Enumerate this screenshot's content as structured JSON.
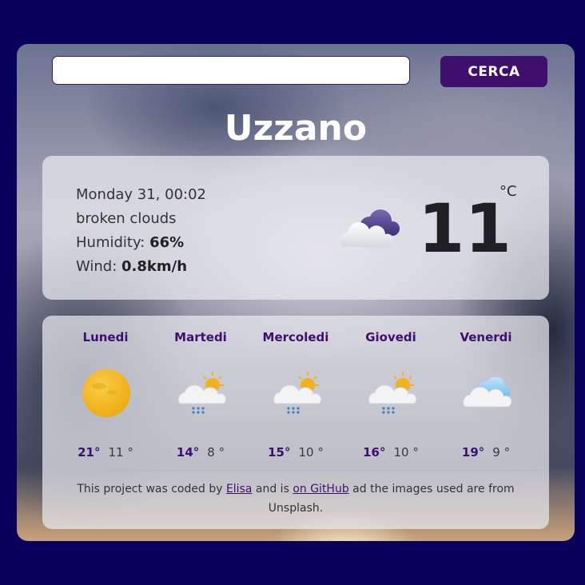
{
  "search": {
    "value": "",
    "placeholder": "",
    "button_label": "CERCA"
  },
  "city": "Uzzano",
  "current": {
    "datetime": "Monday 31, 00:02",
    "description": "broken clouds",
    "humidity_label": "Humidity: ",
    "humidity_value": "66%",
    "wind_label": "Wind: ",
    "wind_value": "0.8km/h",
    "temperature": "11",
    "unit": "°C",
    "icon": "broken-clouds-icon"
  },
  "forecast": [
    {
      "day": "Lunedi",
      "max": "21°",
      "min": "11 °",
      "icon": "sun-icon"
    },
    {
      "day": "Martedi",
      "max": "14°",
      "min": "8 °",
      "icon": "sun-rain-icon"
    },
    {
      "day": "Mercoledi",
      "max": "15°",
      "min": "10 °",
      "icon": "sun-rain-icon"
    },
    {
      "day": "Giovedi",
      "max": "16°",
      "min": "10 °",
      "icon": "sun-rain-icon"
    },
    {
      "day": "Venerdi",
      "max": "19°",
      "min": "9 °",
      "icon": "cloud-icon"
    }
  ],
  "footer": {
    "text_1": "This project was coded by ",
    "link_author": "Elisa",
    "text_2": " and is ",
    "link_github": "on GitHub",
    "text_3": " ad the images used are from Unsplash."
  },
  "colors": {
    "background": "#08005a",
    "accent": "#3e0f6c",
    "sun": "#f2b21c"
  }
}
